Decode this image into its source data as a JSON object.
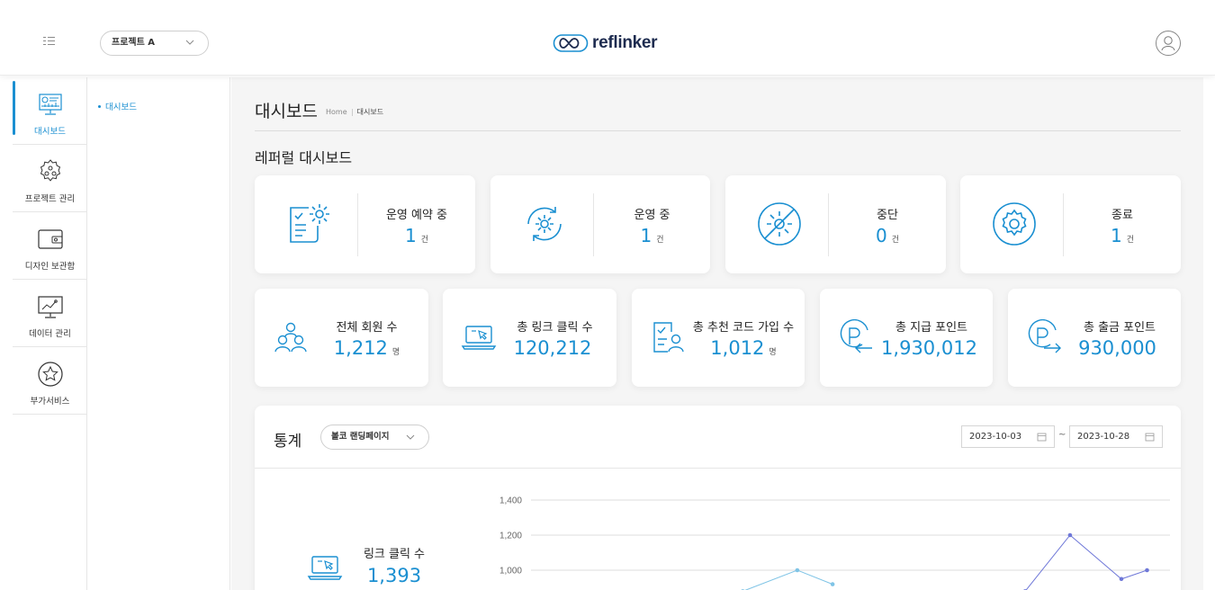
{
  "header": {
    "project_select": "프로젝트 A",
    "logo_text": "reflinker"
  },
  "rail": {
    "items": [
      {
        "label": "대시보드",
        "icon": "dashboard-icon",
        "active": true
      },
      {
        "label": "프로젝트 관리",
        "icon": "project-settings-icon",
        "active": false
      },
      {
        "label": "디자인 보관함",
        "icon": "wallet-icon",
        "active": false
      },
      {
        "label": "데이터 관리",
        "icon": "data-chart-icon",
        "active": false
      },
      {
        "label": "부가서비스",
        "icon": "star-icon",
        "active": false
      }
    ]
  },
  "submenu": {
    "items": [
      {
        "label": "대시보드"
      }
    ]
  },
  "page": {
    "title": "대시보드",
    "breadcrumb_home": "Home",
    "breadcrumb_current": "대시보드",
    "section_title": "레퍼럴 대시보드"
  },
  "status_cards": [
    {
      "name": "운영 예약 중",
      "value": "1",
      "unit": "건",
      "icon": "checklist-gear-icon"
    },
    {
      "name": "운영 중",
      "value": "1",
      "unit": "건",
      "icon": "gear-cycle-icon"
    },
    {
      "name": "중단",
      "value": "0",
      "unit": "건",
      "icon": "gear-stopped-icon"
    },
    {
      "name": "종료",
      "value": "1",
      "unit": "건",
      "icon": "gear-icon"
    }
  ],
  "metric_cards": [
    {
      "name": "전체 회원 수",
      "value": "1,212",
      "unit": "명",
      "icon": "members-icon"
    },
    {
      "name": "총 링크 클릭 수",
      "value": "120,212",
      "unit": "",
      "icon": "laptop-click-icon"
    },
    {
      "name": "총 추천 코드 가입 수",
      "value": "1,012",
      "unit": "명",
      "icon": "referral-signup-icon"
    },
    {
      "name": "총 지급 포인트",
      "value": "1,930,012",
      "unit": "",
      "icon": "point-in-icon"
    },
    {
      "name": "총 출금 포인트",
      "value": "930,000",
      "unit": "",
      "icon": "point-out-icon"
    }
  ],
  "stats": {
    "title": "통계",
    "select_value": "볼코 랜딩페이지",
    "date_from": "2023-10-03",
    "date_to": "2023-10-28",
    "tilde": "~",
    "link_click_label": "링크 클릭 수",
    "link_click_value": "1,393"
  },
  "colors": {
    "accent": "#1a8fd1",
    "series_1": "#7fc4e6",
    "series_2": "#6f78d8"
  },
  "chart_data": {
    "type": "line",
    "yticks": [
      1000,
      1200,
      1400
    ],
    "ytick_labels": [
      "1,000",
      "1,200",
      "1,400"
    ],
    "ylim": [
      900,
      1450
    ],
    "xlim": [
      0,
      1
    ],
    "grid": true,
    "series": [
      {
        "points": [
          [
            0.33,
            880
          ],
          [
            0.415,
            1000
          ],
          [
            0.47,
            920
          ]
        ]
      },
      {
        "points": [
          [
            0.77,
            880
          ],
          [
            0.84,
            1200
          ],
          [
            0.92,
            950
          ],
          [
            0.96,
            1000
          ]
        ]
      }
    ]
  }
}
